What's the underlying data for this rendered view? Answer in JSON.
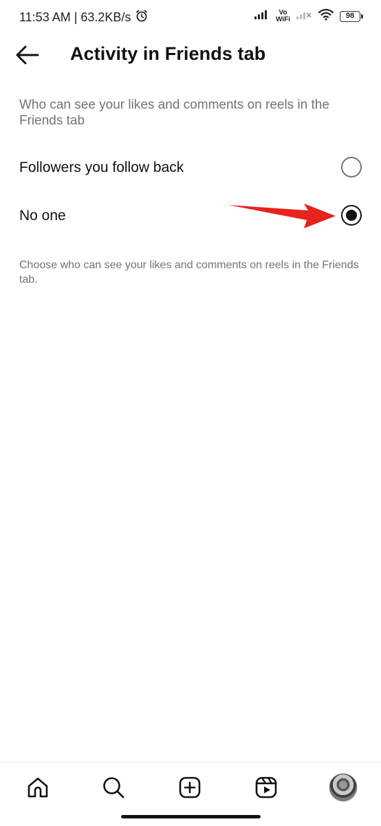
{
  "status_bar": {
    "time_speed": "11:53 AM | 63.2KB/s",
    "vowifi_top": "Vo",
    "vowifi_bottom": "WiFi",
    "battery": "98",
    "icons": [
      "alarm-icon",
      "signal-icon",
      "signal-off-icon",
      "wifi-icon",
      "battery-icon"
    ]
  },
  "header": {
    "title": "Activity in Friends tab",
    "back_icon": "arrow-left-icon"
  },
  "section": {
    "heading": "Who can see your likes and comments on reels in the Friends tab",
    "options": [
      {
        "label": "Followers you follow back",
        "selected": false
      },
      {
        "label": "No one",
        "selected": true
      }
    ],
    "helper": "Choose who can see your likes and comments on reels in the Friends tab."
  },
  "annotation": {
    "color": "#e8221c",
    "type": "arrow"
  },
  "bottom_nav": {
    "items": [
      "home-icon",
      "search-icon",
      "create-icon",
      "reels-icon",
      "profile-avatar"
    ]
  },
  "colors": {
    "text_primary": "#111111",
    "text_secondary": "#737373",
    "background": "#ffffff"
  }
}
